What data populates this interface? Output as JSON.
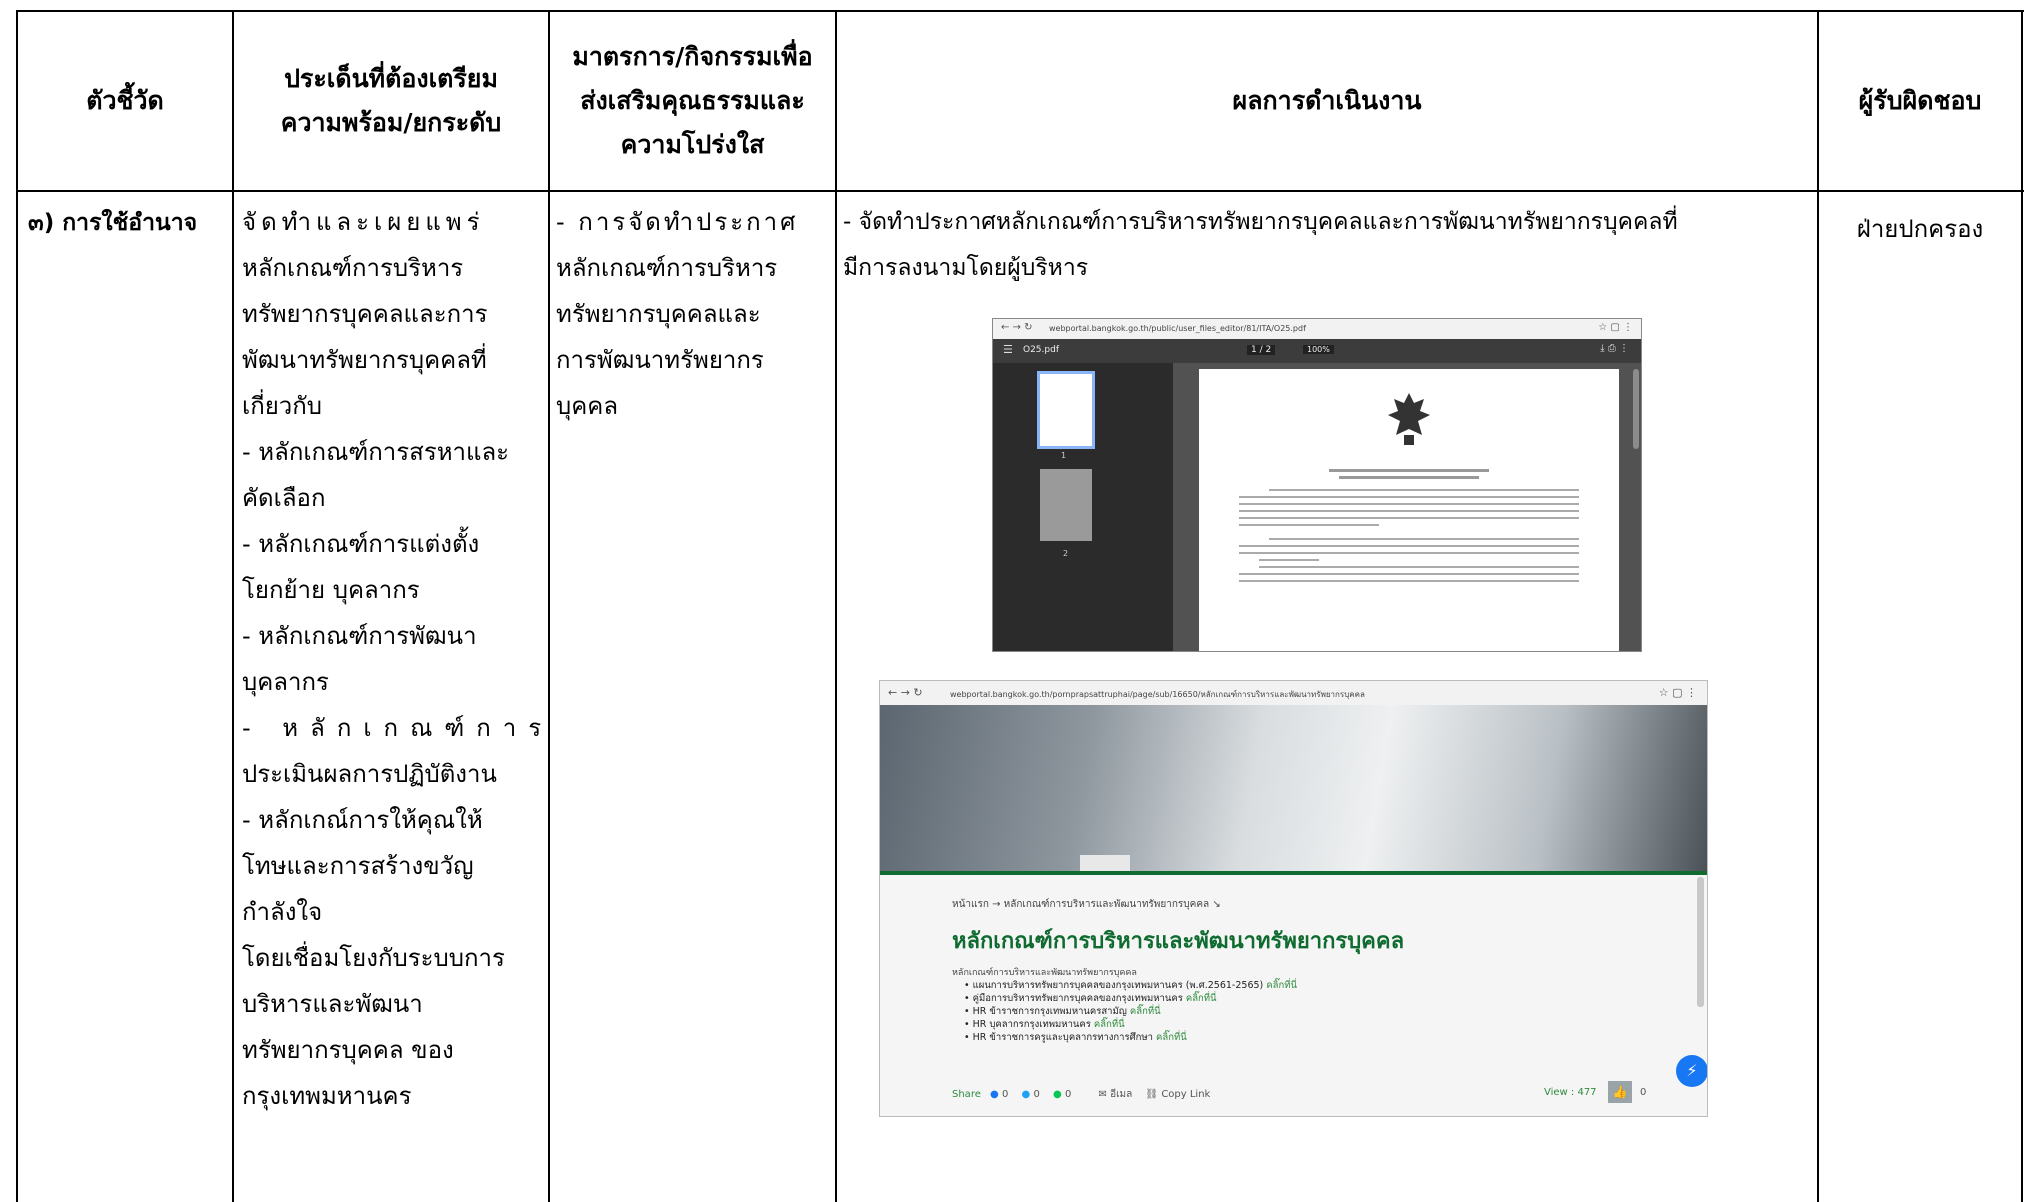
{
  "headers": {
    "indicator": "ตัวชี้วัด",
    "issue": [
      "ประเด็นที่ต้องเตรียม",
      "ความพร้อม/ยกระดับ"
    ],
    "measure": [
      "มาตรการ/กิจกรรมเพื่อ",
      "ส่งเสริมคุณธรรมและ",
      "ความโปร่งใส"
    ],
    "result": "ผลการดำเนินงาน",
    "owner": "ผู้รับผิดชอบ"
  },
  "row": {
    "indicator": "๓) การใช้อำนาจ",
    "issue_lines": [
      "จัดทำและเผยแพร่",
      "หลักเกณฑ์การบริหาร",
      "ทรัพยากรบุคคลและการ",
      "พัฒนาทรัพยากรบุคคลที่",
      "เกี่ยวกับ",
      "- หลักเกณฑ์การสรหาและ",
      "คัดเลือก",
      "- หลักเกณฑ์การแต่งตั้ง",
      "โยกย้าย บุคลากร",
      "- หลักเกณฑ์การพัฒนา",
      "บุคลากร",
      "- หลักเกณฑ์การ",
      "ประเมินผลการปฏิบัติงาน",
      "- หลักเกณ์การให้คุณให้",
      "โทษและการสร้างขวัญ",
      "กำลังใจ",
      "โดยเชื่อมโยงกับระบบการ",
      "บริหารและพัฒนา",
      "ทรัพยากรบุคคล ของ",
      "กรุงเทพมหานคร"
    ],
    "measure_lines": [
      "- การจัดทำประกาศ",
      "หลักเกณฑ์การบริหาร",
      "ทรัพยากรบุคคลและ",
      "การพัฒนาทรัพยากร",
      "บุคคล"
    ],
    "result_lines": [
      "- จัดทำประกาศหลักเกณฑ์การบริหารทรัพยากรบุคคลและการพัฒนาทรัพยากรบุคคลที่",
      "มีการลงนามโดยผู้บริหาร"
    ],
    "owner": "ฝ่ายปกครอง"
  },
  "screenshot1": {
    "url": "webportal.bangkok.go.th/public/user_files_editor/81/ITA/O25.pdf",
    "file_name": "O25.pdf",
    "page_indicator": "1 / 2",
    "zoom": "100%",
    "thumb_labels": [
      "1",
      "2"
    ]
  },
  "screenshot2": {
    "url": "webportal.bangkok.go.th/pornprapsattruphai/page/sub/16650/หลักเกณฑ์การบริหารและพัฒนาทรัพยากรบุคคล",
    "breadcrumb": "หน้าแรก → หลักเกณฑ์การบริหารและพัฒนาทรัพยากรบุคคล ↘",
    "title": "หลักเกณฑ์การบริหารและพัฒนาทรัพยากรบุคคล",
    "subtitle": "หลักเกณฑ์การบริหารและพัฒนาทรัพยากรบุคคล",
    "items": [
      {
        "text": "แผนการบริหารทรัพยากรบุคคลของกรุงเทพมหานคร (พ.ศ.2561-2565)",
        "link": "คลิ๊กที่นี่"
      },
      {
        "text": "คู่มือการบริหารทรัพยากรบุคคลของกรุงเทพมหานคร",
        "link": "คลิ๊กที่นี่"
      },
      {
        "text": "HR ข้าราชการกรุงเทพมหานครสามัญ",
        "link": "คลิ๊กที่นี่"
      },
      {
        "text": "HR บุคลากรกรุงเทพมหานคร",
        "link": "คลิ๊กที่นี่"
      },
      {
        "text": "HR ข้าราชการครูและบุคลากรทางการศึกษา",
        "link": "คลิ๊กที่นี่"
      }
    ],
    "share_label": "Share",
    "share_counts": [
      "0",
      "0",
      "0"
    ],
    "email_label": "อีเมล",
    "copy_label": "Copy Link",
    "view_label": "View : 477",
    "like_count": "0"
  },
  "colors": {
    "border": "#000000",
    "pdf_toolbar": "#3c3c3c",
    "pdf_sidebar": "#2b2b2b",
    "site_green": "#0f6b2f",
    "link_green": "#2e8b3e",
    "messenger_blue": "#1877f2"
  }
}
